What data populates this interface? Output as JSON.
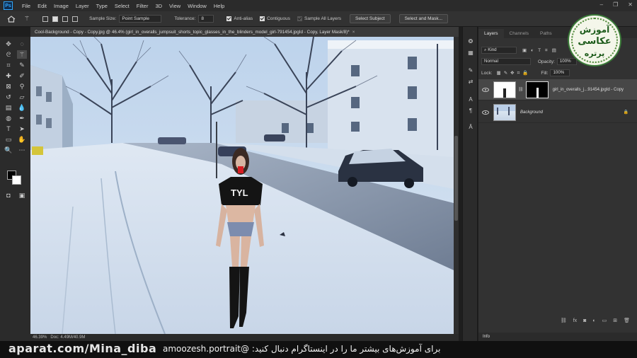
{
  "menubar": {
    "app_icon": "Ps",
    "items": [
      "File",
      "Edit",
      "Image",
      "Layer",
      "Type",
      "Select",
      "Filter",
      "3D",
      "View",
      "Window",
      "Help"
    ]
  },
  "options": {
    "sample_size_label": "Sample Size:",
    "sample_size_value": "Point Sample",
    "tolerance_label": "Tolerance:",
    "tolerance_value": "8",
    "anti_alias_label": "Anti-alias",
    "contiguous_label": "Contiguous",
    "sample_all_layers_label": "Sample All Layers",
    "select_subject_label": "Select Subject",
    "select_and_mask_label": "Select and Mask..."
  },
  "document": {
    "tab_title": "Cool-Background - Copy - Copy.jpg @ 46.4% (girl_in_overalls_jumpsuit_shorts_topic_glasses_in_the_blinders_model_girl-791454.jpgId - Copy, Layer Mask/8)*",
    "zoom_status": "46.39%",
    "doc_status": "Doc: 4.49M/40.9M",
    "shirt_text": "TYL"
  },
  "panel": {
    "tabs": [
      "Layers",
      "Channels",
      "Paths"
    ],
    "active_tab": "Layers",
    "filter_kind": "Kind",
    "blend_mode": "Normal",
    "opacity_label": "Opacity:",
    "opacity_value": "100%",
    "lock_label": "Lock:",
    "fill_label": "Fill:",
    "fill_value": "100%",
    "layers": [
      {
        "name": "girl_in_overalls_j...91454.jpgId - Copy",
        "selected": true
      },
      {
        "name": "Background",
        "selected": false
      }
    ],
    "info_label": "Info"
  },
  "watermark": {
    "line1": "آموزش",
    "line2": "عکاسی",
    "line3": "پرتره"
  },
  "caption": {
    "left": "aparat.com/Mina_diba",
    "right": "برای آموزش‌های بیشتر ما را در اینستاگرام دنبال کنید:  @amoozesh.portrait"
  },
  "colors": {
    "accent": "#31a8ff",
    "sky": "#c9dbef",
    "snow": "#e3ecf6",
    "road": "#7d8aa0"
  }
}
